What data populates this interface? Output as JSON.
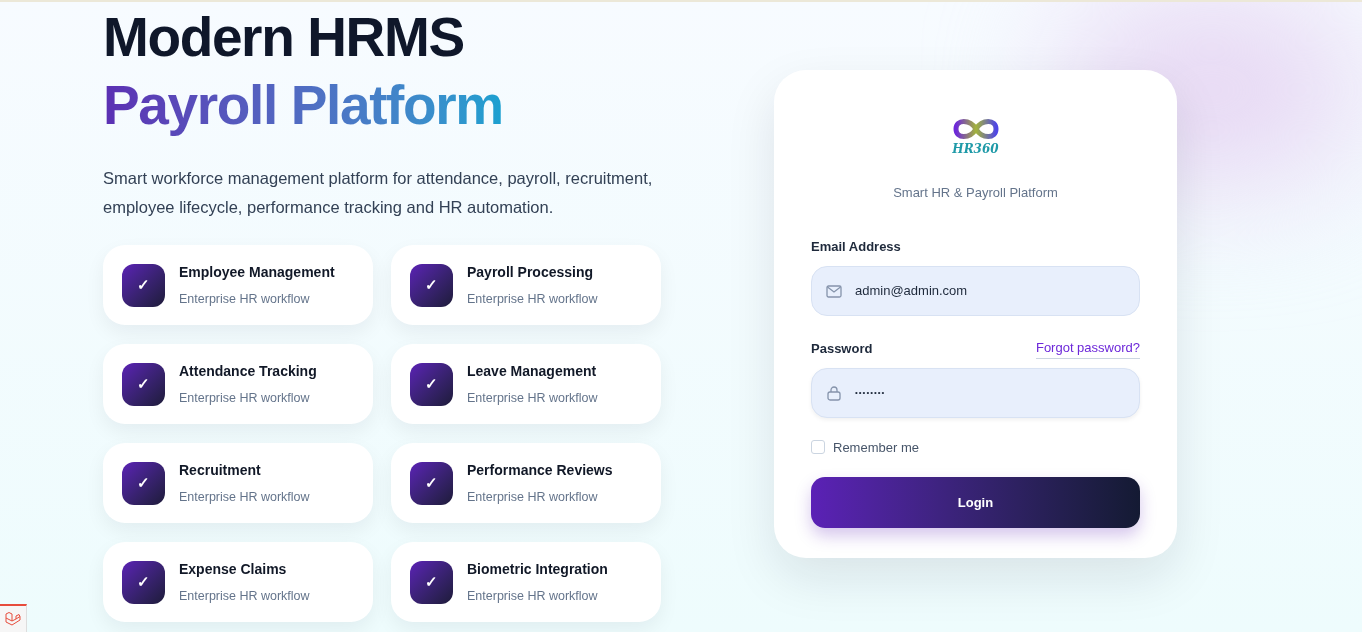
{
  "hero": {
    "title_line_1": "Modern HRMS",
    "title_line_2": "Payroll Platform",
    "description": "Smart workforce management platform for attendance, payroll, recruitment, employee lifecycle, performance tracking and HR automation."
  },
  "features": [
    {
      "check": "✓",
      "title": "Employee Management",
      "subtitle": "Enterprise HR workflow"
    },
    {
      "check": "✓",
      "title": "Payroll Processing",
      "subtitle": "Enterprise HR workflow"
    },
    {
      "check": "✓",
      "title": "Attendance Tracking",
      "subtitle": "Enterprise HR workflow"
    },
    {
      "check": "✓",
      "title": "Leave Management",
      "subtitle": "Enterprise HR workflow"
    },
    {
      "check": "✓",
      "title": "Recruitment",
      "subtitle": "Enterprise HR workflow"
    },
    {
      "check": "✓",
      "title": "Performance Reviews",
      "subtitle": "Enterprise HR workflow"
    },
    {
      "check": "✓",
      "title": "Expense Claims",
      "subtitle": "Enterprise HR workflow"
    },
    {
      "check": "✓",
      "title": "Biometric Integration",
      "subtitle": "Enterprise HR workflow"
    }
  ],
  "login": {
    "logo_text": "HR360",
    "tagline": "Smart HR & Payroll Platform",
    "email_label": "Email Address",
    "email_value": "admin@admin.com",
    "password_label": "Password",
    "forgot_link": "Forgot password?",
    "password_value": "••••••••",
    "remember_label": "Remember me",
    "remember_checked": false,
    "button": "Login"
  }
}
